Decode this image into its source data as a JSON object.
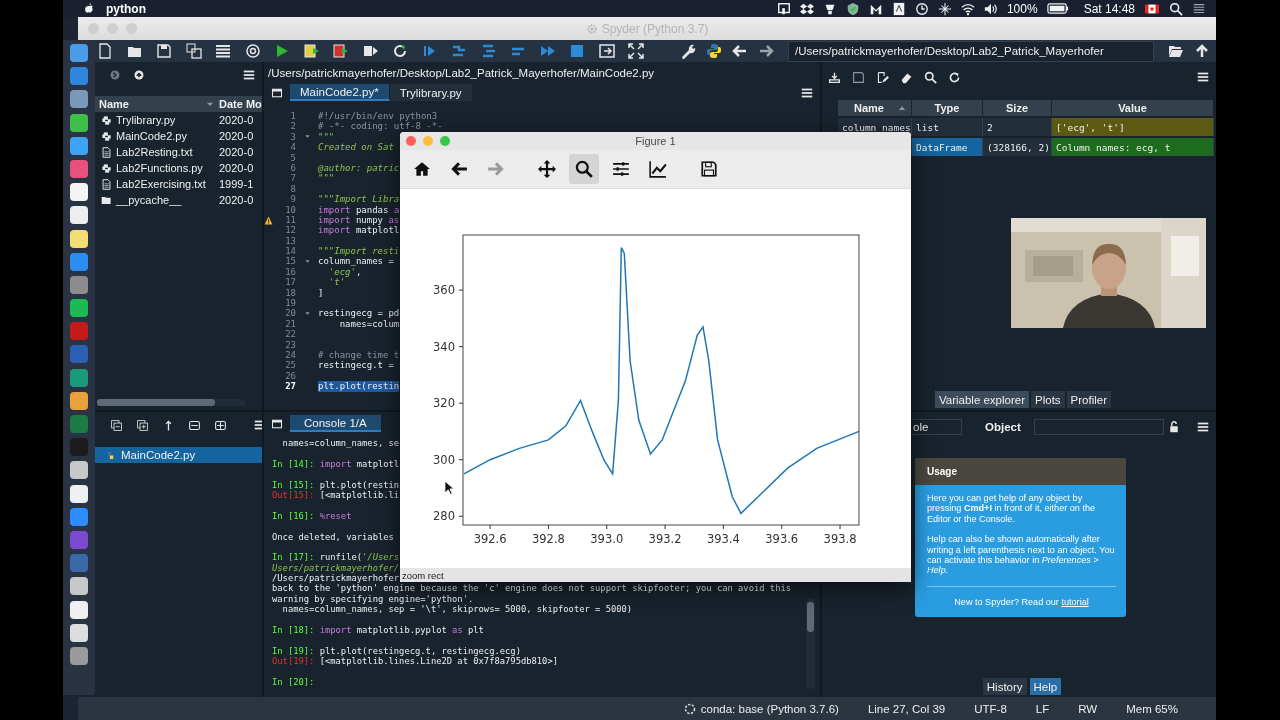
{
  "menubar": {
    "app": "python",
    "battery": "100%",
    "clock": "Sat 14:48"
  },
  "window": {
    "title": "Spyder (Python 3.7)"
  },
  "toolbar": {
    "path": "/Users/patrickmayerhofer/Desktop/Lab2_Patrick_Mayerhofer"
  },
  "file_explorer": {
    "columns": [
      "Name",
      "Date Mo"
    ],
    "files": [
      {
        "name": "Trylibrary.py",
        "date": "2020-0",
        "kind": "python"
      },
      {
        "name": "MainCode2.py",
        "date": "2020-0",
        "kind": "python"
      },
      {
        "name": "Lab2Resting.txt",
        "date": "2020-0",
        "kind": "text"
      },
      {
        "name": "Lab2Functions.py",
        "date": "2020-0",
        "kind": "python"
      },
      {
        "name": "Lab2Exercising.txt",
        "date": "1999-1",
        "kind": "text"
      },
      {
        "name": "__pycache__",
        "date": "2020-0",
        "kind": "folder"
      }
    ]
  },
  "outline": {
    "items": [
      {
        "name": "MainCode2.py",
        "selected": true
      }
    ]
  },
  "editor": {
    "path": "/Users/patrickmayerhofer/Desktop/Lab2_Patrick_Mayerhofer/MainCode2.py",
    "tabs": [
      {
        "label": "MainCode2.py*",
        "selected": true
      },
      {
        "label": "Trylibrary.py",
        "selected": false
      }
    ],
    "lines": [
      {
        "no": "1",
        "parts": [
          {
            "kind": "comment",
            "text": "#!/usr/bin/env python3"
          }
        ],
        "fold": false,
        "warning": false,
        "current": false
      },
      {
        "no": "2",
        "parts": [
          {
            "kind": "comment",
            "text": "# -*- coding: utf-8 -*-"
          }
        ],
        "fold": false,
        "warning": false,
        "current": false
      },
      {
        "no": "3",
        "parts": [
          {
            "kind": "docstring",
            "text": "\"\"\""
          }
        ],
        "fold": true,
        "warning": false,
        "current": false
      },
      {
        "no": "4",
        "parts": [
          {
            "kind": "docstring",
            "text": "Created on Sat"
          }
        ],
        "fold": false,
        "warning": false,
        "current": false
      },
      {
        "no": "5",
        "fold": false,
        "warning": false,
        "current": false
      },
      {
        "no": "6",
        "parts": [
          {
            "kind": "docstring",
            "text": "@author: patric"
          }
        ],
        "fold": false,
        "warning": false,
        "current": false
      },
      {
        "no": "7",
        "parts": [
          {
            "kind": "docstring",
            "text": "\"\"\""
          }
        ],
        "fold": false,
        "warning": false,
        "current": false
      },
      {
        "no": "8",
        "fold": false,
        "warning": false,
        "current": false
      },
      {
        "no": "9",
        "parts": [
          {
            "kind": "docstring",
            "text": "\"\"\"Import Libra"
          }
        ],
        "fold": false,
        "warning": false,
        "current": false
      },
      {
        "no": "10",
        "parts": [
          {
            "kind": "keyword",
            "text": "import"
          },
          {
            "kind": "code",
            "text": " pandas "
          },
          {
            "kind": "keyword",
            "text": "a"
          }
        ],
        "fold": false,
        "warning": false,
        "current": false
      },
      {
        "no": "11",
        "parts": [
          {
            "kind": "keyword",
            "text": "import"
          },
          {
            "kind": "code",
            "text": " numpy "
          },
          {
            "kind": "keyword",
            "text": "as"
          }
        ],
        "fold": false,
        "warning": true,
        "current": false
      },
      {
        "no": "12",
        "parts": [
          {
            "kind": "keyword",
            "text": "import"
          },
          {
            "kind": "code",
            "text": " matplotl"
          }
        ],
        "fold": false,
        "warning": false,
        "current": false
      },
      {
        "no": "13",
        "fold": false,
        "warning": false,
        "current": false
      },
      {
        "no": "14",
        "parts": [
          {
            "kind": "docstring",
            "text": "\"\"\"Import resti"
          }
        ],
        "fold": false,
        "warning": false,
        "current": false
      },
      {
        "no": "15",
        "parts": [
          {
            "kind": "code",
            "text": "column_names ="
          }
        ],
        "fold": true,
        "warning": false,
        "current": false
      },
      {
        "no": "16",
        "parts": [
          {
            "kind": "string",
            "text": "  'ecg'"
          },
          {
            "kind": "code",
            "text": ","
          }
        ],
        "fold": false,
        "warning": false,
        "current": false
      },
      {
        "no": "17",
        "parts": [
          {
            "kind": "string",
            "text": "  't'"
          }
        ],
        "fold": false,
        "warning": false,
        "current": false
      },
      {
        "no": "18",
        "parts": [
          {
            "kind": "code",
            "text": "]"
          }
        ],
        "fold": false,
        "warning": false,
        "current": false
      },
      {
        "no": "19",
        "fold": false,
        "warning": false,
        "current": false
      },
      {
        "no": "20",
        "parts": [
          {
            "kind": "code",
            "text": "restingecg = pd"
          }
        ],
        "fold": true,
        "warning": false,
        "current": false
      },
      {
        "no": "21",
        "parts": [
          {
            "kind": "code",
            "text": "    names=colum"
          }
        ],
        "fold": false,
        "warning": false,
        "current": false
      },
      {
        "no": "22",
        "fold": false,
        "warning": false,
        "current": false
      },
      {
        "no": "23",
        "fold": false,
        "warning": false,
        "current": false
      },
      {
        "no": "24",
        "parts": [
          {
            "kind": "comment",
            "text": "# change time t"
          }
        ],
        "fold": false,
        "warning": false,
        "current": false
      },
      {
        "no": "25",
        "parts": [
          {
            "kind": "code",
            "text": "restingecg.t ="
          }
        ],
        "fold": false,
        "warning": false,
        "current": false
      },
      {
        "no": "26",
        "fold": false,
        "warning": false,
        "current": false
      },
      {
        "no": "27",
        "parts": [
          {
            "kind": "code",
            "text": "plt.plot(restin"
          }
        ],
        "fold": false,
        "warning": false,
        "current": true
      }
    ]
  },
  "console": {
    "tab": "Console 1/A",
    "lines": [
      {
        "kind": "text",
        "parts": [
          {
            "kind": "code",
            "text": "  names=column_names, se"
          }
        ]
      },
      {
        "kind": "blank"
      },
      {
        "kind": "in",
        "prompt": "In [14]:",
        "parts": [
          {
            "kind": "keyword",
            "text": "import"
          },
          {
            "kind": "code",
            "text": " matplotl"
          }
        ]
      },
      {
        "kind": "blank"
      },
      {
        "kind": "in",
        "prompt": "In [15]:",
        "parts": [
          {
            "kind": "code",
            "text": "plt.plot(restin"
          }
        ]
      },
      {
        "kind": "out",
        "prompt": "Out[15]:",
        "parts": [
          {
            "kind": "code",
            "text": "[<matplotlib.li"
          }
        ]
      },
      {
        "kind": "blank"
      },
      {
        "kind": "in",
        "prompt": "In [16]:",
        "parts": [
          {
            "kind": "keyword",
            "text": "%reset"
          }
        ]
      },
      {
        "kind": "blank"
      },
      {
        "kind": "text",
        "parts": [
          {
            "kind": "code",
            "text": "Once deleted, variables"
          }
        ]
      },
      {
        "kind": "blank"
      },
      {
        "kind": "in",
        "prompt": "In [17]:",
        "parts": [
          {
            "kind": "code",
            "text": "runfile("
          },
          {
            "kind": "string",
            "text": "'/Users"
          }
        ]
      },
      {
        "kind": "text",
        "parts": [
          {
            "kind": "string",
            "text": "Users/patrickmayerhofer/"
          }
        ]
      },
      {
        "kind": "text",
        "parts": [
          {
            "kind": "code",
            "text": "/Users/patrickmayerhofer"
          }
        ]
      },
      {
        "kind": "text",
        "parts": [
          {
            "kind": "code",
            "text": "back to the 'python' engine because the 'c' engine does not support skipfooter; you can avoid this"
          }
        ]
      },
      {
        "kind": "text",
        "parts": [
          {
            "kind": "code",
            "text": "warning by specifying engine='python'."
          }
        ]
      },
      {
        "kind": "text",
        "parts": [
          {
            "kind": "code",
            "text": "  names=column_names, sep = '\\t', skiprows= 5000, skipfooter = 5000)"
          }
        ]
      },
      {
        "kind": "blank"
      },
      {
        "kind": "in",
        "prompt": "In [18]:",
        "parts": [
          {
            "kind": "keyword",
            "text": "import"
          },
          {
            "kind": "code",
            "text": " matplotlib.pyplot "
          },
          {
            "kind": "keyword",
            "text": "as"
          },
          {
            "kind": "code",
            "text": " plt"
          }
        ]
      },
      {
        "kind": "blank"
      },
      {
        "kind": "in",
        "prompt": "In [19]:",
        "parts": [
          {
            "kind": "code",
            "text": "plt.plot(restingecg.t, restingecg.ecg)"
          }
        ]
      },
      {
        "kind": "out",
        "prompt": "Out[19]:",
        "parts": [
          {
            "kind": "code",
            "text": "[<matplotlib.lines.Line2D at 0x7f8a795db810>]"
          }
        ]
      },
      {
        "kind": "blank"
      },
      {
        "kind": "in",
        "prompt": "In [20]:"
      }
    ]
  },
  "variable_explorer": {
    "columns": [
      "Name",
      "Type",
      "Size",
      "Value"
    ],
    "rows": [
      {
        "name": "column_names",
        "type": "list",
        "size": "2",
        "value": "['ecg', 't']",
        "color": "#5c5a12",
        "selected": false
      },
      {
        "type": "DataFrame",
        "size": "(328166, 2)",
        "value": "Column names: ecg, t",
        "color": "#1d6b1d",
        "selected": true
      }
    ]
  },
  "right_tabs": [
    {
      "label": "Variable explorer",
      "selected": true
    },
    {
      "label": "Plots",
      "selected": false
    },
    {
      "label": "Profiler",
      "selected": false
    }
  ],
  "help": {
    "source": "ole",
    "object_label": "Object",
    "usage": {
      "title": "Usage",
      "paragraphs": [
        "Here you can get help of any object by pressing **Cmd+I** in front of it, either on the Editor or the Console.",
        "Help can also be shown automatically after writing a left parenthesis next to an object. You can activate this behavior in *Preferences > Help.*"
      ],
      "footer": "New to Spyder? Read our ",
      "link": "tutorial"
    }
  },
  "bottom_tabs": [
    {
      "label": "History",
      "selected": false
    },
    {
      "label": "Help",
      "selected": true
    }
  ],
  "figure": {
    "title": "Figure 1",
    "status": "zoom rect",
    "tools": [
      {
        "kind": "home",
        "selected": false,
        "disabled": false
      },
      {
        "kind": "back",
        "selected": false,
        "disabled": false
      },
      {
        "kind": "forward",
        "selected": false,
        "disabled": true
      },
      {
        "kind": "pan",
        "selected": false,
        "disabled": false
      },
      {
        "kind": "zoom",
        "selected": true,
        "disabled": false
      },
      {
        "kind": "configure",
        "selected": false,
        "disabled": false
      },
      {
        "kind": "edit",
        "selected": false,
        "disabled": false
      },
      {
        "kind": "save",
        "selected": false,
        "disabled": false
      }
    ],
    "chart_data": {
      "type": "line",
      "xlim": [
        392.507,
        393.865
      ],
      "ylim": [
        276.9,
        379.5
      ],
      "xticks": [
        {
          "value": 392.6,
          "label": "392.6"
        },
        {
          "value": 392.8,
          "label": "392.8"
        },
        {
          "value": 393.0,
          "label": "393.0"
        },
        {
          "value": 393.2,
          "label": "393.2"
        },
        {
          "value": 393.4,
          "label": "393.4"
        },
        {
          "value": 393.6,
          "label": "393.6"
        },
        {
          "value": 393.8,
          "label": "393.8"
        }
      ],
      "yticks": [
        280,
        300,
        320,
        340,
        360
      ],
      "x": [
        392.51,
        392.6,
        392.7,
        392.8,
        392.86,
        392.91,
        392.95,
        392.99,
        393.02,
        393.04,
        393.05,
        393.06,
        393.08,
        393.11,
        393.15,
        393.19,
        393.27,
        393.31,
        393.33,
        393.35,
        393.38,
        393.43,
        393.46,
        393.52,
        393.62,
        393.72,
        393.865
      ],
      "series": [
        {
          "color": "#1f77b4",
          "values": [
            295,
            300,
            304,
            307,
            312,
            321,
            310,
            300,
            295,
            321,
            375,
            373,
            335,
            314,
            302,
            307,
            328,
            344,
            347,
            335,
            307,
            287,
            281,
            287,
            297,
            304,
            310
          ]
        }
      ]
    }
  },
  "status_bar": {
    "env": "conda: base (Python 3.7.6)",
    "position": "Line 27, Col 39",
    "encoding": "UTF-8",
    "eol": "LF",
    "mode": "RW",
    "memory": "Mem 65%"
  }
}
